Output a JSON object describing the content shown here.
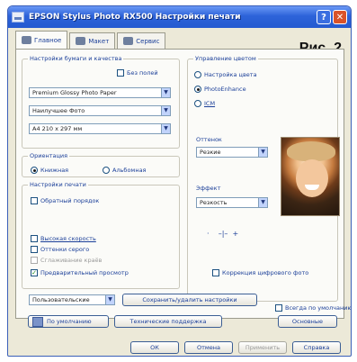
{
  "window": {
    "title": "EPSON Stylus Photo RX500 Настройки печати",
    "help_label": "?",
    "close_label": "✕"
  },
  "figure_label": "Рис. 2",
  "tabs": [
    {
      "label": "Главное",
      "active": true
    },
    {
      "label": "Макет",
      "active": false
    },
    {
      "label": "Сервис",
      "active": false
    }
  ],
  "paper_quality": {
    "title": "Настройки бумаги и качества",
    "borderless_label": "Без полей",
    "media_type": "Premium Glossy Photo Paper",
    "quality": "Наилучшее Фото",
    "paper_size": "A4 210 x 297 мм"
  },
  "orientation": {
    "title": "Ориентация",
    "portrait_label": "Книжная",
    "landscape_label": "Альбомная"
  },
  "print_options": {
    "title": "Настройки печати",
    "reverse_order_label": "Обратный порядок",
    "high_speed_label": "Высокая скорость",
    "edge_smoothing_label": "Оттенки серого",
    "disabled_option_label": "Сглаживание краёв",
    "preview_label": "Предварительный просмотр"
  },
  "color_management": {
    "title": "Управление цветом",
    "option_1": "Настройка цвета",
    "option_2": "PhotoEnhance",
    "option_3": "ICM"
  },
  "tone": {
    "label": "Оттенок",
    "value": "Резкие"
  },
  "effect": {
    "label": "Эффект",
    "value": "Резкость"
  },
  "digital_camera_label": "Коррекция цифрового фото",
  "bottom": {
    "preset_value": "Пользовательские",
    "save_settings_label": "Сохранить/удалить настройки",
    "always_print_label": "Всегда по умолчанию",
    "defaults_label": "По умолчанию",
    "ink_levels_label": "Технические поддержка",
    "advanced_label": "Основные"
  },
  "footer": {
    "ok_label": "ОК",
    "cancel_label": "Отмена",
    "apply_label": "Применить",
    "help_label": "Справка"
  },
  "colors": {
    "title_bar": "#245ad0",
    "label_text": "#1b3f99",
    "window_bg": "#ece9d8"
  }
}
